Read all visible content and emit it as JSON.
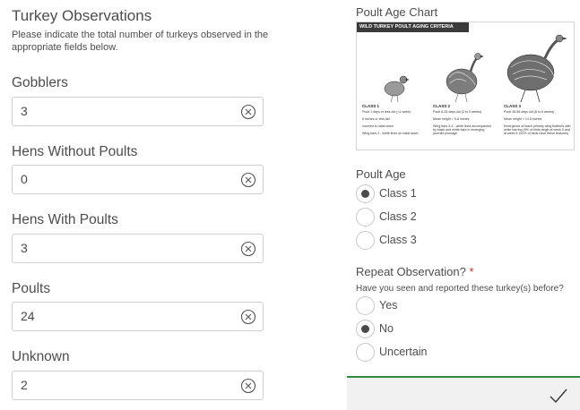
{
  "section": {
    "title": "Turkey Observations",
    "description": "Please indicate the total number of turkeys observed in the appropriate fields below."
  },
  "fields": [
    {
      "label": "Gobblers",
      "value": "3"
    },
    {
      "label": "Hens Without Poults",
      "value": "0"
    },
    {
      "label": "Hens With Poults",
      "value": "3"
    },
    {
      "label": "Poults",
      "value": "24"
    },
    {
      "label": "Unknown",
      "value": "2"
    }
  ],
  "chart": {
    "title": "Poult Age Chart",
    "header": "WILD TURKEY POULT AGING CRITERIA",
    "classes": [
      {
        "name": "CLASS 1",
        "bullets": [
          "Poult 1 days or less old (<1 week)",
          "6 inches or less tall",
          "covered in natal down",
          "Wing bars 2 - white lines on natal down"
        ]
      },
      {
        "name": "CLASS 2",
        "bullets": [
          "Poult 8-35 days old (2 to 5 weeks)",
          "Mean height = 5-8 inches",
          "Wing bars 3-4 - white lines accompanied by black and white bars in emerging juvenile plumage"
        ]
      },
      {
        "name": "CLASS 3",
        "bullets": [
          "Poult 36-56 days old (6 to 8 weeks)",
          "Mean height = 14.5 inches",
          "Emergence of black primary wing feathers with white barring (9% of birds begin at week 5 and at week 6 100% of birds have these features)"
        ]
      }
    ]
  },
  "poult_age": {
    "label": "Poult Age",
    "options": [
      "Class 1",
      "Class 2",
      "Class 3"
    ],
    "selected": "Class 1"
  },
  "repeat": {
    "label": "Repeat Observation?",
    "required_mark": "*",
    "hint": "Have you seen and reported these turkey(s) before?",
    "options": [
      "Yes",
      "No",
      "Uncertain"
    ],
    "selected": "No"
  },
  "colors": {
    "accent_line": "#2e8b3e",
    "required": "#c0392b"
  },
  "icons": {
    "clear": "clear-circle-x-icon",
    "submit": "checkmark-icon"
  }
}
